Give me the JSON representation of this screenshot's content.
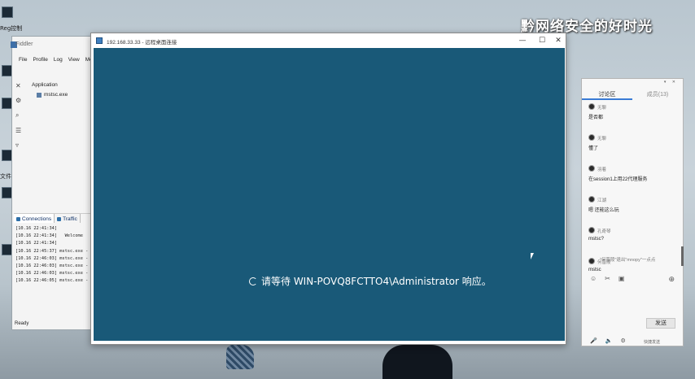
{
  "desktop": {
    "watermark": "黔网络安全的好时光",
    "icon_labels": [
      "Reg控制",
      "",
      "",
      "",
      "",
      "",
      "文件"
    ]
  },
  "app_window": {
    "title": "Fiddler",
    "menu": [
      "File",
      "Profile",
      "Log",
      "View",
      "Me"
    ],
    "tree_header": "Application",
    "tree_item": "mstsc.exe",
    "tabs": [
      {
        "label": "Connections",
        "active": true,
        "icon": "plug-icon"
      },
      {
        "label": "Traffic",
        "active": false,
        "icon": "chart-icon"
      }
    ],
    "log_lines": [
      "[10.16 22:41:34]",
      "[10.16 22:41:34]   Welcome",
      "[10.16 22:41:34]",
      "[10.16 22:45:37] mstsc.exe -",
      "[10.16 22:46:03] mstsc.exe -",
      "[10.16 22:46:03] mstsc.exe -",
      "[10.16 22:46:03] mstsc.exe -",
      "[10.16 22:46:05] mstsc.exe -"
    ],
    "status": "Ready"
  },
  "rdp_window": {
    "title": "192.168.33.33 - 远程桌面连接",
    "minimize": "—",
    "maximize": "☐",
    "close": "✕",
    "waiting_text": "请等待 WIN-POVQ8FCTTO4\\Administrator 响应。",
    "screen_color": "#195978"
  },
  "chat": {
    "header_icons": "▾ ✕",
    "tabs": [
      {
        "label": "讨论区",
        "active": true
      },
      {
        "label": "成员(13)",
        "active": false
      }
    ],
    "messages": [
      {
        "name": "无聊",
        "text": "是否都"
      },
      {
        "name": "无聊",
        "text": "懂了"
      },
      {
        "name": "羽着",
        "text": "在session1上用22代理服务"
      },
      {
        "name": "江湖",
        "text": "嗯 还能这么玩"
      },
      {
        "name": "孔奇琴",
        "text": "mstsc?"
      },
      {
        "name": "何晋陵",
        "text": "mstsc"
      }
    ],
    "hint": "\"何晋陵\"退出\"mnopy\"一点点",
    "tools": [
      "☺",
      "✂",
      "▣"
    ],
    "add": "⊕",
    "send_label": "发送",
    "bottom_icons": [
      "🎤",
      "🔈",
      "⚙"
    ],
    "bottom_text": "快捷发送"
  }
}
